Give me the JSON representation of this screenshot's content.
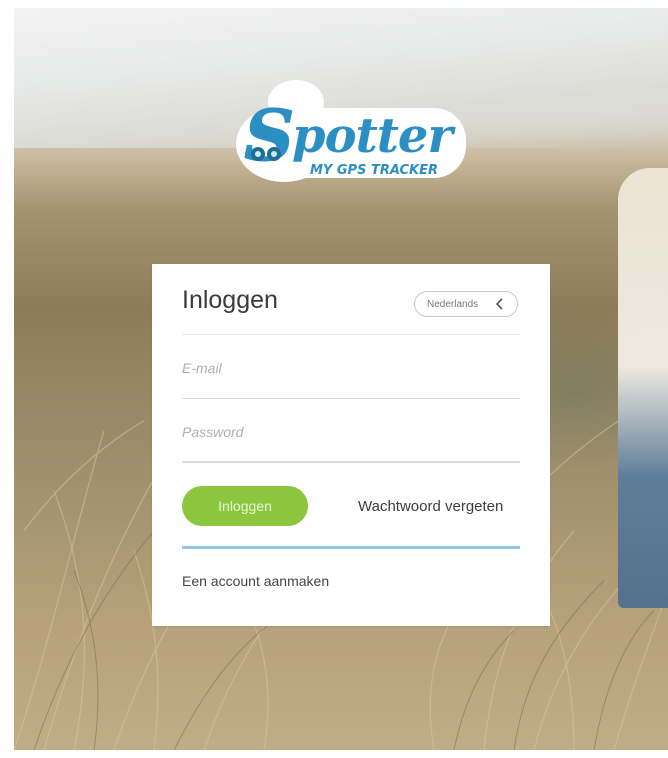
{
  "brand": {
    "name": "Spotter",
    "tagline": "MY GPS TRACKER"
  },
  "login": {
    "title": "Inloggen",
    "language": {
      "selected": "Nederlands",
      "icon": "chevron-left-icon"
    },
    "email": {
      "placeholder": "E-mail",
      "value": ""
    },
    "password": {
      "placeholder": "Password",
      "value": ""
    },
    "submit_label": "Inloggen",
    "forgot_label": "Wachtwoord vergeten",
    "create_account_label": "Een account aanmaken"
  },
  "colors": {
    "accent_green": "#8cc63f",
    "accent_blue": "#8fc7e6",
    "logo_blue": "#2c8fc4",
    "text_dark": "#3b3b3b"
  }
}
